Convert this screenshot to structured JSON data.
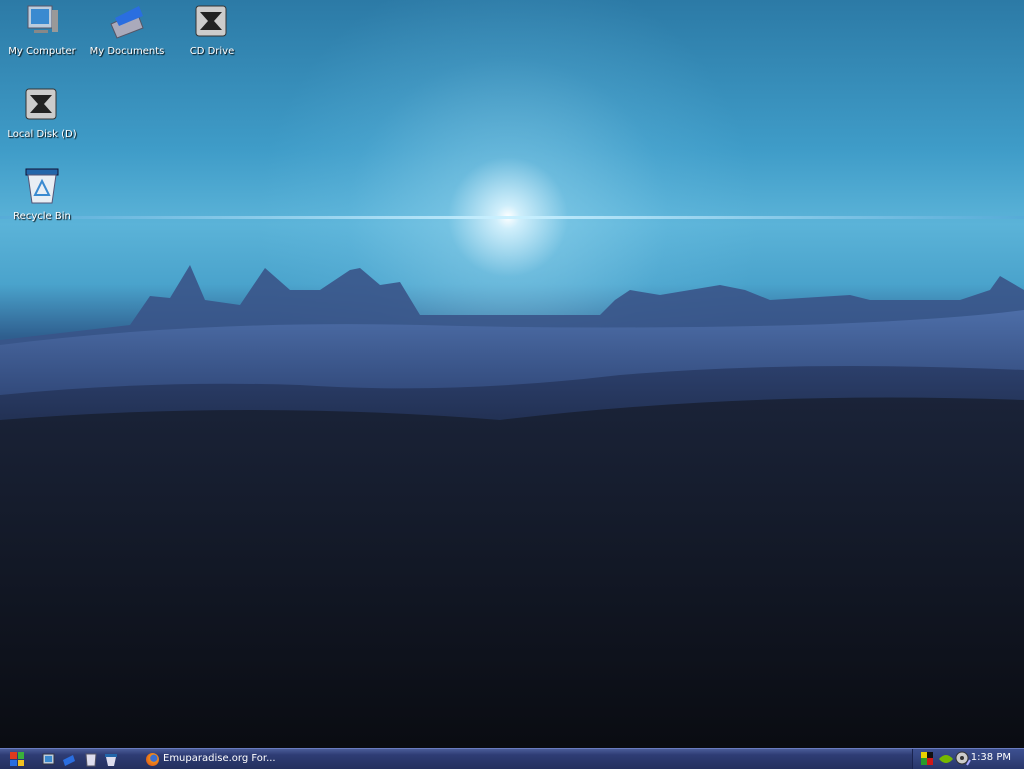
{
  "desktop": {
    "icons": [
      {
        "label": "My Computer",
        "icon": "my-computer-icon"
      },
      {
        "label": "My Documents",
        "icon": "my-documents-icon"
      },
      {
        "label": "CD Drive",
        "icon": "cd-drive-icon"
      },
      {
        "label": "Local Disk (D)",
        "icon": "local-disk-icon"
      },
      {
        "label": "Recycle Bin",
        "icon": "recycle-bin-icon"
      }
    ]
  },
  "taskbar": {
    "quick_launch": [
      "show-desktop-icon",
      "my-documents-icon",
      "recycle-bin-icon",
      "recycle-bin-icon"
    ],
    "task": {
      "label": "Emuparadise.org For...",
      "icon": "firefox-icon"
    },
    "tray": {
      "icons": [
        "network-icon",
        "nvidia-icon",
        "volume-icon"
      ],
      "clock": "1:38 PM"
    }
  }
}
